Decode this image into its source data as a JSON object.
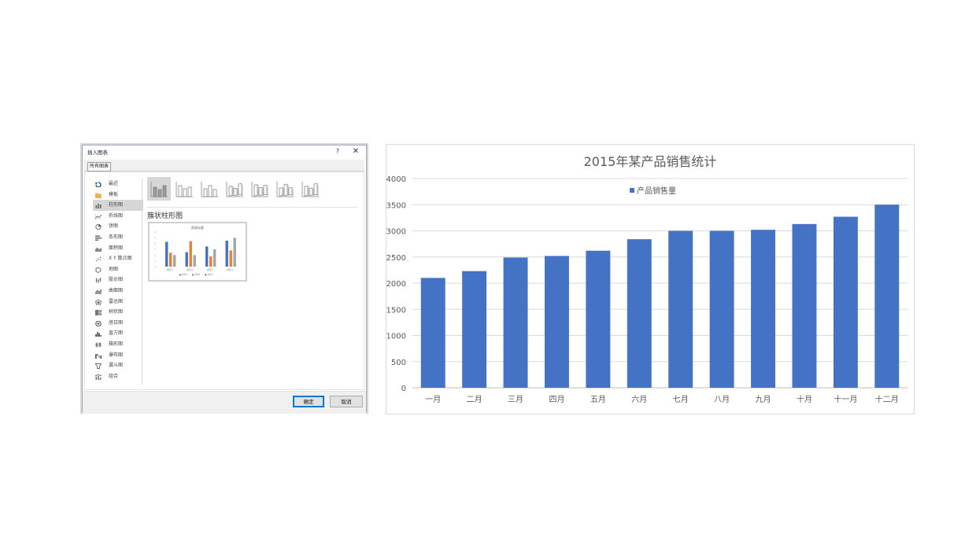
{
  "dialog": {
    "title": "插入图表",
    "help_label": "?",
    "close_label": "✕",
    "tab_label": "所有图表",
    "chart_types": [
      {
        "label": "最近",
        "icon": "recent-icon"
      },
      {
        "label": "模板",
        "icon": "folder-icon"
      },
      {
        "label": "柱形图",
        "icon": "column-chart-icon"
      },
      {
        "label": "折线图",
        "icon": "line-chart-icon"
      },
      {
        "label": "饼图",
        "icon": "pie-chart-icon"
      },
      {
        "label": "条形图",
        "icon": "bar-chart-icon"
      },
      {
        "label": "面积图",
        "icon": "area-chart-icon"
      },
      {
        "label": "X Y 散点图",
        "icon": "scatter-chart-icon"
      },
      {
        "label": "地图",
        "icon": "map-chart-icon"
      },
      {
        "label": "股价图",
        "icon": "stock-chart-icon"
      },
      {
        "label": "曲面图",
        "icon": "surface-chart-icon"
      },
      {
        "label": "雷达图",
        "icon": "radar-chart-icon"
      },
      {
        "label": "树状图",
        "icon": "treemap-chart-icon"
      },
      {
        "label": "旭日图",
        "icon": "sunburst-chart-icon"
      },
      {
        "label": "直方图",
        "icon": "histogram-chart-icon"
      },
      {
        "label": "箱形图",
        "icon": "boxplot-chart-icon"
      },
      {
        "label": "瀑布图",
        "icon": "waterfall-chart-icon"
      },
      {
        "label": "漏斗图",
        "icon": "funnel-chart-icon"
      },
      {
        "label": "组合",
        "icon": "combo-chart-icon"
      }
    ],
    "selected_type_index": 2,
    "subtype_count": 7,
    "selected_subtype_index": 0,
    "subtype_title": "簇状柱形图",
    "preview": {
      "title": "图表标题",
      "categories": [
        "类别 1",
        "类别 2",
        "类别 3",
        "类别 4"
      ],
      "legend": [
        "■ 系列1",
        "■ 系列2",
        "■ 系列3"
      ],
      "series_values": [
        [
          4.3,
          2.5,
          3.5,
          4.5
        ],
        [
          2.4,
          4.4,
          1.8,
          2.8
        ],
        [
          2,
          2,
          3,
          5
        ]
      ],
      "colors": [
        "#4472c4",
        "#ed7d31",
        "#a5a5a5"
      ]
    },
    "ok_label": "确定",
    "cancel_label": "取消"
  },
  "chart_data": {
    "type": "bar",
    "title": "2015年某产品销售统计",
    "categories": [
      "一月",
      "二月",
      "三月",
      "四月",
      "五月",
      "六月",
      "七月",
      "八月",
      "九月",
      "十月",
      "十一月",
      "十二月"
    ],
    "series": [
      {
        "name": "产品销售量",
        "values": [
          2100,
          2230,
          2490,
          2520,
          2620,
          2840,
          3000,
          3000,
          3020,
          3130,
          3270,
          3500
        ],
        "color": "#4472c4"
      }
    ],
    "ylim": [
      0,
      4000
    ],
    "yticks": [
      0,
      500,
      1000,
      1500,
      2000,
      2500,
      3000,
      3500,
      4000
    ],
    "grid": true,
    "legend_position": "top"
  }
}
